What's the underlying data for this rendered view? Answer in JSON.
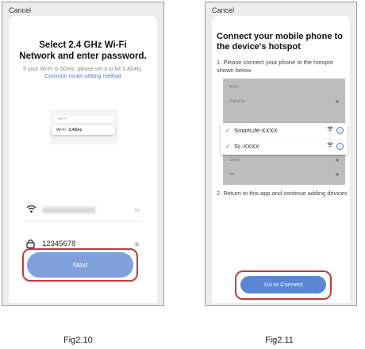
{
  "fig210": {
    "cancel": "Cancel",
    "title_line1": "Select 2.4 GHz Wi-Fi",
    "title_line2": "Network and enter password.",
    "subtitle_text": "If your Wi-Fi is 5GHz, please set it to be 2.4GHz.",
    "subtitle_link": "Common router setting method",
    "illustration": {
      "row1": "Wi-Fi",
      "row2_label": "Wi-Fi",
      "row2_band": "2.4Ghz"
    },
    "password_value": "12345678",
    "next_label": "Next",
    "caption": "Fig2.10"
  },
  "fig211": {
    "cancel": "Cancel",
    "title_line1": "Connect your mobile phone to",
    "title_line2": "the device's hotspot",
    "step1": "1. Please connect your phone to the hotspot shown below",
    "step2": "2. Return to this app and continue adding devices",
    "screenshot_rows": [
      "Wi-Fi",
      "Digital-m",
      "Direct",
      "No"
    ],
    "hotspots": [
      {
        "name": "SmartLife-XXXX"
      },
      {
        "name": "SL-XXXX"
      }
    ],
    "connect_label": "Go to Connect",
    "caption": "Fig2.11"
  },
  "colors": {
    "accent": "#3a7bd5",
    "button": "#5b86d4",
    "highlight": "#c23b3b"
  }
}
